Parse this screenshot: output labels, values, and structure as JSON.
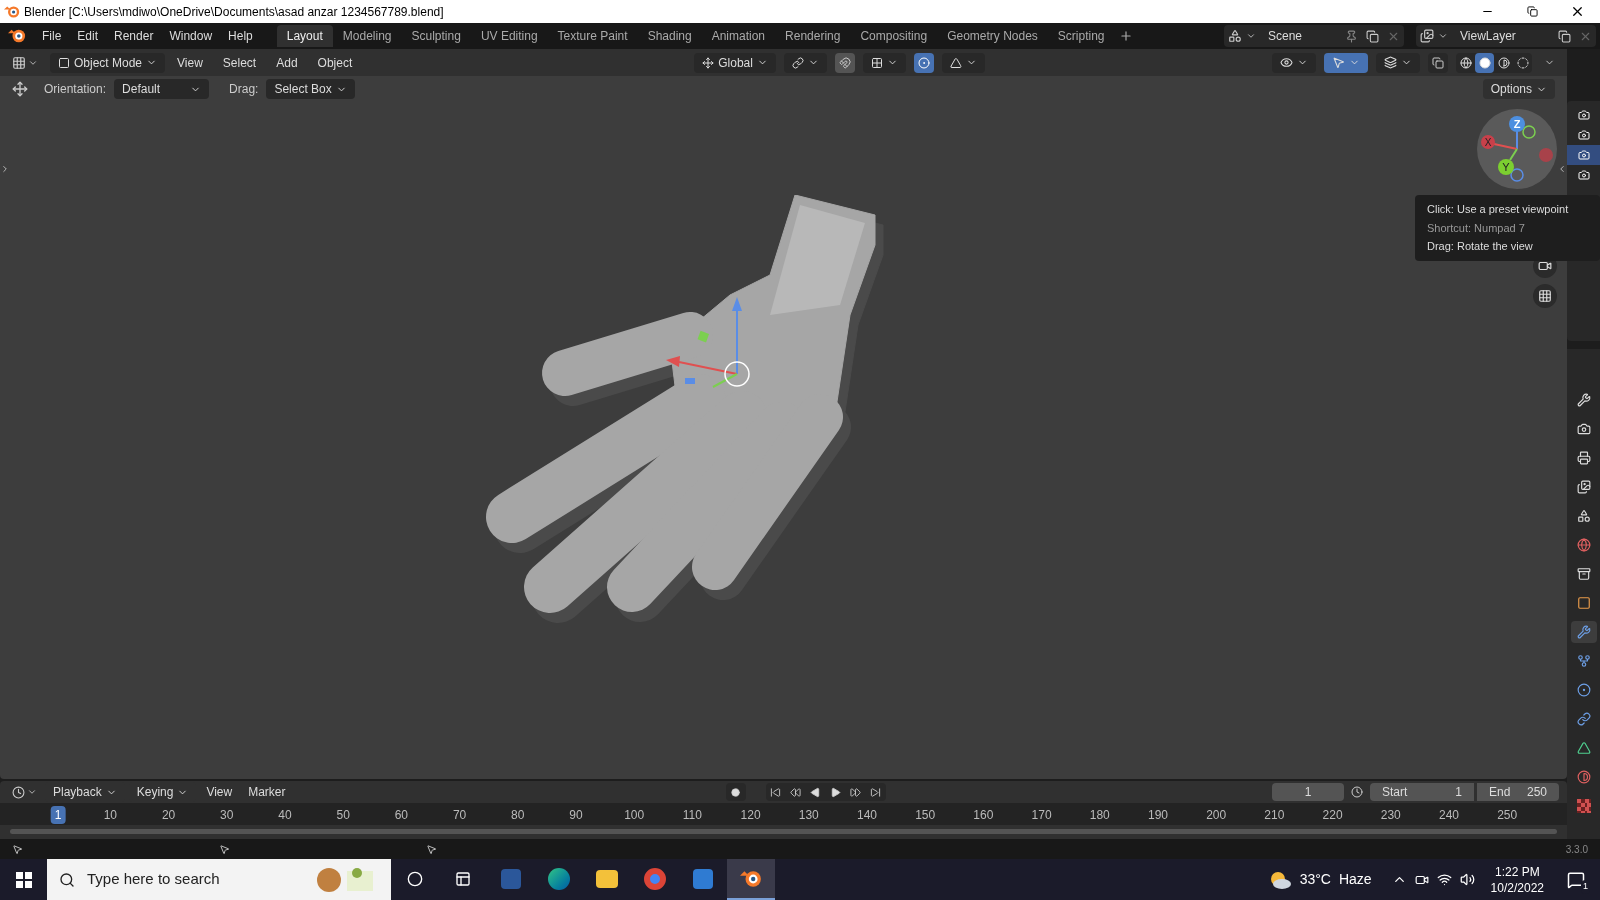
{
  "window": {
    "title": "Blender [C:\\Users\\mdiwo\\OneDrive\\Documents\\asad anzar 1234567789.blend]"
  },
  "menu": [
    "File",
    "Edit",
    "Render",
    "Window",
    "Help"
  ],
  "workspaces": [
    {
      "label": "Layout",
      "selected": true
    },
    {
      "label": "Modeling",
      "selected": false
    },
    {
      "label": "Sculpting",
      "selected": false
    },
    {
      "label": "UV Editing",
      "selected": false
    },
    {
      "label": "Texture Paint",
      "selected": false
    },
    {
      "label": "Shading",
      "selected": false
    },
    {
      "label": "Animation",
      "selected": false
    },
    {
      "label": "Rendering",
      "selected": false
    },
    {
      "label": "Compositing",
      "selected": false
    },
    {
      "label": "Geometry Nodes",
      "selected": false
    },
    {
      "label": "Scripting",
      "selected": false
    }
  ],
  "scene": "Scene",
  "view_layer": "ViewLayer",
  "header": {
    "mode": "Object Mode",
    "menus": [
      "View",
      "Select",
      "Add",
      "Object"
    ],
    "transform": "Global",
    "proportional_on": true,
    "gizmos_on": true
  },
  "shading": [
    {
      "kind": "wireframe",
      "selected": false
    },
    {
      "kind": "solid",
      "selected": true
    },
    {
      "kind": "material",
      "selected": false
    },
    {
      "kind": "rendered",
      "selected": false
    }
  ],
  "tool_settings": {
    "orientation_label": "Orientation:",
    "orientation": "Default",
    "drag_label": "Drag:",
    "drag": "Select Box",
    "options": "Options"
  },
  "gizmo": {
    "x": "X",
    "y": "Y",
    "z": "Z"
  },
  "tooltip": [
    {
      "text": "Click: Use a preset viewpoint",
      "dim": false
    },
    {
      "text": "Shortcut: Numpad 7",
      "dim": true
    },
    {
      "text": "Drag: Rotate the view",
      "dim": false
    }
  ],
  "outliner_toggles": [
    {
      "selected": false
    },
    {
      "selected": false
    },
    {
      "selected": true
    },
    {
      "selected": false
    }
  ],
  "properties_tabs": [
    {
      "kind": "tool",
      "selected": false
    },
    {
      "kind": "render",
      "selected": false
    },
    {
      "kind": "output",
      "selected": false
    },
    {
      "kind": "view_layer",
      "selected": false
    },
    {
      "kind": "scene",
      "selected": false
    },
    {
      "kind": "world",
      "selected": false
    },
    {
      "kind": "collection",
      "selected": false
    },
    {
      "kind": "object",
      "selected": false
    },
    {
      "kind": "modifier",
      "selected": true
    },
    {
      "kind": "particles",
      "selected": false
    },
    {
      "kind": "physics",
      "selected": false
    },
    {
      "kind": "constraints",
      "selected": false
    },
    {
      "kind": "data",
      "selected": false
    },
    {
      "kind": "material",
      "selected": false
    },
    {
      "kind": "texture",
      "selected": false
    }
  ],
  "timeline": {
    "menus": [
      "Playback",
      "Keying",
      "View",
      "Marker"
    ],
    "current_frame": "1",
    "start_label": "Start",
    "start": "1",
    "end_label": "End",
    "end": "250",
    "ticks": [
      {
        "label": "1",
        "selected": true
      },
      {
        "label": "10",
        "selected": false
      },
      {
        "label": "20",
        "selected": false
      },
      {
        "label": "30",
        "selected": false
      },
      {
        "label": "40",
        "selected": false
      },
      {
        "label": "50",
        "selected": false
      },
      {
        "label": "60",
        "selected": false
      },
      {
        "label": "70",
        "selected": false
      },
      {
        "label": "80",
        "selected": false
      },
      {
        "label": "90",
        "selected": false
      },
      {
        "label": "100",
        "selected": false
      },
      {
        "label": "110",
        "selected": false
      },
      {
        "label": "120",
        "selected": false
      },
      {
        "label": "130",
        "selected": false
      },
      {
        "label": "140",
        "selected": false
      },
      {
        "label": "150",
        "selected": false
      },
      {
        "label": "160",
        "selected": false
      },
      {
        "label": "170",
        "selected": false
      },
      {
        "label": "180",
        "selected": false
      },
      {
        "label": "190",
        "selected": false
      },
      {
        "label": "200",
        "selected": false
      },
      {
        "label": "210",
        "selected": false
      },
      {
        "label": "220",
        "selected": false
      },
      {
        "label": "230",
        "selected": false
      },
      {
        "label": "240",
        "selected": false
      },
      {
        "label": "250",
        "selected": false
      }
    ]
  },
  "status_bar": {
    "version": "3.3.0"
  },
  "taskbar": {
    "search_placeholder": "Type here to search",
    "apps": [
      {
        "kind": "cortana",
        "selected": false
      },
      {
        "kind": "task_view",
        "selected": false
      },
      {
        "kind": "word",
        "selected": false
      },
      {
        "kind": "edge",
        "selected": false
      },
      {
        "kind": "explorer",
        "selected": false
      },
      {
        "kind": "chrome",
        "selected": false
      },
      {
        "kind": "store",
        "selected": false
      },
      {
        "kind": "blender",
        "selected": true
      }
    ],
    "temperature": "33°C",
    "weather": "Haze",
    "time": "1:22 PM",
    "date": "10/2/2022",
    "notifications": "1"
  }
}
